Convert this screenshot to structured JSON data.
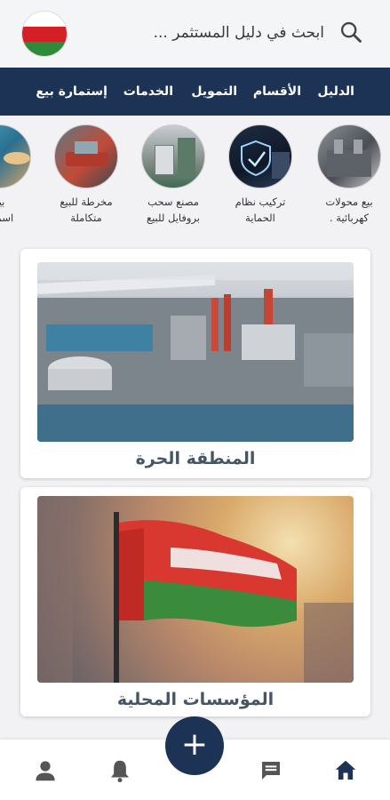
{
  "header": {
    "search_placeholder": "ابحث في دليل المستثمر ...",
    "flag_icon": "oman-flag-icon"
  },
  "nav": {
    "items": [
      {
        "label": "الدليل"
      },
      {
        "label": "الأقسام"
      },
      {
        "label": "التمويل"
      },
      {
        "label": "الخدمات"
      },
      {
        "label": "إستمارة بيع"
      }
    ]
  },
  "categories": [
    {
      "label": "بيع  محولات\nكهربائية ."
    },
    {
      "label": "تركيب نظام\nالحماية"
    },
    {
      "label": "مصنع سحب\nبروفايل  للبيع"
    },
    {
      "label": "مخرطة للبيع\nمتكاملة"
    },
    {
      "label": "بيع\nاسماك"
    }
  ],
  "cards": [
    {
      "title": "المنطقة الحرة"
    },
    {
      "title": "المؤسسات المحلية"
    }
  ],
  "bottom_nav": {
    "fab_label": "+",
    "items": [
      "home-icon",
      "chat-icon",
      "bell-icon",
      "user-icon"
    ]
  },
  "colors": {
    "primary": "#1c3355",
    "title": "#445566"
  }
}
